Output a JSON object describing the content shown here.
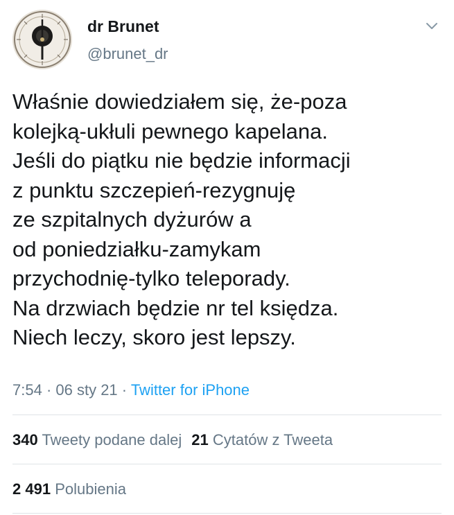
{
  "author": {
    "display_name": "dr Brunet",
    "username": "@brunet_dr",
    "avatar_icon": "barometer-avatar-icon"
  },
  "menu_icon": "chevron-down-icon",
  "tweet": {
    "lines": [
      "Właśnie dowiedziałem się, że-poza",
      "kolejką-ukłuli pewnego kapelana.",
      "Jeśli do piątku nie będzie informacji",
      "z punktu szczepień-rezygnuję",
      "ze szpitalnych dyżurów a",
      "od poniedziałku-zamykam",
      "przychodnię-tylko teleporady.",
      "Na drzwiach będzie nr tel księdza.",
      "Niech leczy, skoro jest lepszy."
    ]
  },
  "meta": {
    "time": "7:54",
    "separator": " · ",
    "date": "06 sty 21",
    "source": "Twitter for iPhone"
  },
  "stats": {
    "retweets_count": "340",
    "retweets_label": "Tweety podane dalej",
    "quotes_count": "21",
    "quotes_label": "Cytatów z Tweeta",
    "likes_count": "2 491",
    "likes_label": "Polubienia"
  },
  "colors": {
    "text": "#14171a",
    "secondary": "#657786",
    "link": "#1da1f2",
    "divider": "#dfe3e7"
  }
}
